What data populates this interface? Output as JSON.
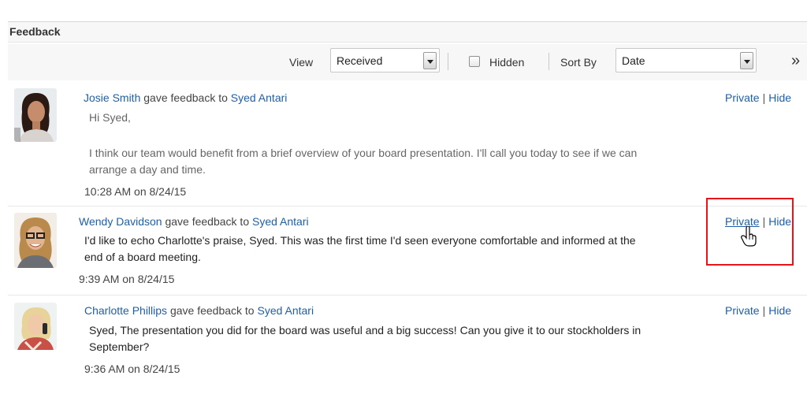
{
  "panel": {
    "title": "Feedback"
  },
  "toolbar": {
    "view_label": "View",
    "view_value": "Received",
    "hidden_label": "Hidden",
    "hidden_checked": false,
    "sort_label": "Sort By",
    "sort_value": "Date",
    "more_label": "»"
  },
  "feedback": [
    {
      "author": "Josie Smith",
      "verb": " gave feedback to ",
      "recipient": "Syed Antari",
      "line1": "Hi Syed,",
      "line2": "I think our team would benefit from a brief overview of your board presentation. I'll call you today to see if we can",
      "line3": "arrange a day and time.",
      "timestamp": "10:28 AM on 8/24/15",
      "private": "Private",
      "hide": "Hide"
    },
    {
      "author": "Wendy Davidson",
      "verb": " gave feedback to ",
      "recipient": "Syed Antari",
      "line1": "I'd like to echo Charlotte's praise, Syed. This was the first time I'd seen everyone comfortable and informed at the",
      "line2": "end of a board meeting.",
      "timestamp": "9:39 AM on 8/24/15",
      "private": "Private",
      "hide": "Hide"
    },
    {
      "author": "Charlotte Phillips",
      "verb": " gave feedback to ",
      "recipient": "Syed Antari",
      "line1": "Syed, The presentation you did for the board was useful and a big success! Can you give it to our stockholders in",
      "line2": "September?",
      "timestamp": "9:36 AM on 8/24/15",
      "private": "Private",
      "hide": "Hide"
    }
  ]
}
